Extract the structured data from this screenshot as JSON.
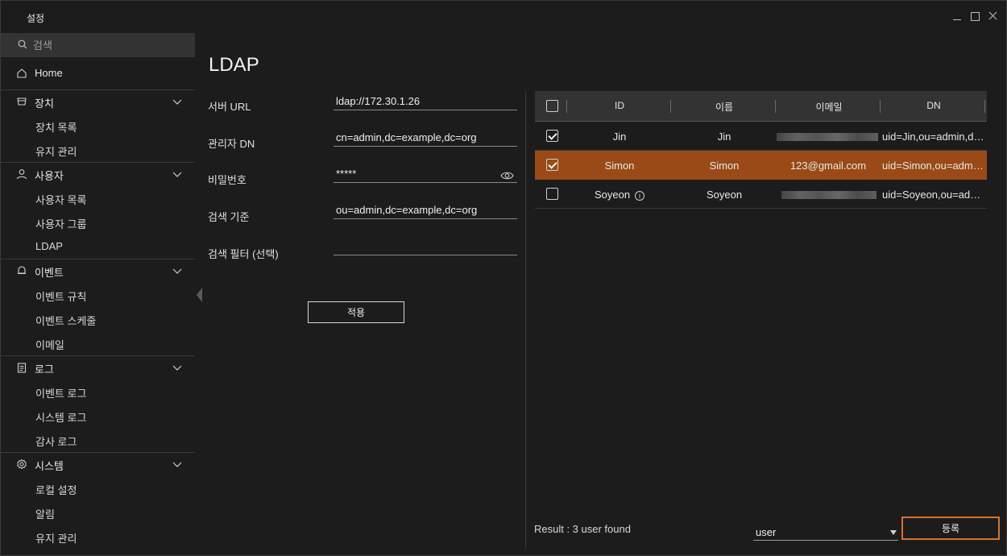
{
  "window": {
    "title": "설정"
  },
  "sidebar": {
    "search_placeholder": "검색",
    "home": "Home",
    "groups": [
      {
        "label": "장치",
        "items": [
          "장치 목록",
          "유지 관리"
        ]
      },
      {
        "label": "사용자",
        "items": [
          "사용자 목록",
          "사용자 그룹",
          "LDAP"
        ]
      },
      {
        "label": "이벤트",
        "items": [
          "이벤트 규칙",
          "이벤트 스케줄",
          "이메일"
        ]
      },
      {
        "label": "로그",
        "items": [
          "이벤트 로그",
          "시스템 로그",
          "감사 로그"
        ]
      },
      {
        "label": "시스템",
        "items": [
          "로컬 설정",
          "알림",
          "유지 관리"
        ]
      }
    ]
  },
  "main": {
    "title": "LDAP",
    "form": {
      "server_url_label": "서버 URL",
      "server_url_value": "ldap://172.30.1.26",
      "admin_dn_label": "관리자 DN",
      "admin_dn_value": "cn=admin,dc=example,dc=org",
      "password_label": "비밀번호",
      "password_value": "*****",
      "search_base_label": "검색 기준",
      "search_base_value": "ou=admin,dc=example,dc=org",
      "search_filter_label": "검색 필터 (선택)",
      "search_filter_value": "",
      "apply_label": "적용"
    },
    "table": {
      "columns": [
        "ID",
        "이름",
        "이메일",
        "DN"
      ],
      "rows": [
        {
          "id": "Jin",
          "name": "Jin",
          "email": "",
          "dn": "uid=Jin,ou=admin,dc=example,dc=org",
          "checked": true,
          "selected": false,
          "info": false
        },
        {
          "id": "Simon",
          "name": "Simon",
          "email": "123@gmail.com",
          "dn": "uid=Simon,ou=admin,dc=example,dc=org",
          "checked": true,
          "selected": true,
          "info": false
        },
        {
          "id": "Soyeon",
          "name": "Soyeon",
          "email": "",
          "dn": "uid=Soyeon,ou=admin,dc=example,dc=org",
          "checked": false,
          "selected": false,
          "info": true
        }
      ]
    },
    "result_text": "Result : 3 user found",
    "type_select_value": "user",
    "register_label": "등록"
  },
  "colors": {
    "accent": "#d8722c",
    "selected_row": "#9a4a16",
    "background": "#1c1c1c",
    "header_bg": "#333333"
  }
}
